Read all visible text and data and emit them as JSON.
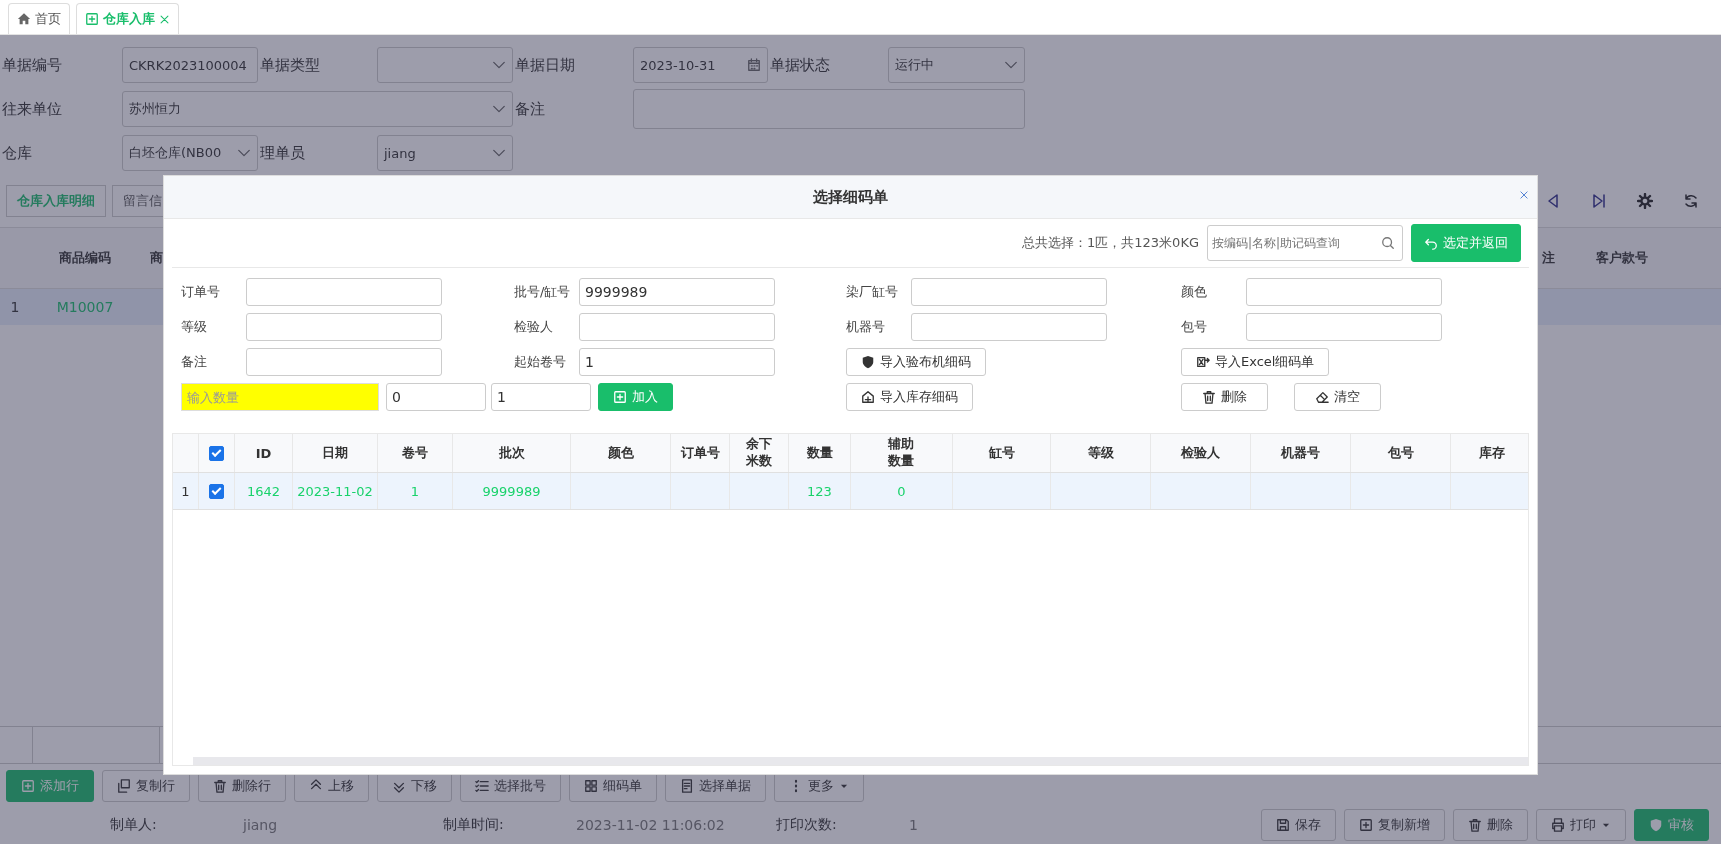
{
  "top_tabs": [
    {
      "label": "首页",
      "selected": false,
      "closable": false
    },
    {
      "label": "仓库入库",
      "selected": true,
      "closable": true
    }
  ],
  "form": {
    "fields": [
      {
        "label": "单据编号",
        "kind": "text",
        "value": "CKRK2023100004"
      },
      {
        "label": "单据类型",
        "kind": "select"
      },
      {
        "label": "单据日期",
        "kind": "date",
        "value": "2023-10-31"
      },
      {
        "label": "单据状态",
        "kind": "select",
        "value": "运行中"
      },
      {
        "label": "往来单位",
        "kind": "lookup",
        "value": "苏州恒力"
      },
      {
        "label": "备注",
        "kind": "textarea"
      },
      {
        "label": "仓库",
        "kind": "select",
        "value": "白坯仓库(NB00"
      },
      {
        "label": "理单员",
        "kind": "select",
        "value": "jiang"
      }
    ]
  },
  "detail_tabs": [
    {
      "label": "仓库入库明细",
      "selected": true
    },
    {
      "label": "留言信",
      "selected": false
    }
  ],
  "grid": {
    "columns": [
      "商品编码",
      "商",
      "注",
      "客户款号"
    ],
    "rows": [
      {
        "index": "1",
        "code": "M10007",
        "selected": true
      }
    ]
  },
  "toolbar": [
    {
      "label": "添加行",
      "kind": "primary"
    },
    {
      "label": "复制行",
      "kind": "default"
    },
    {
      "label": "删除行",
      "kind": "default"
    },
    {
      "label": "上移",
      "kind": "default"
    },
    {
      "label": "下移",
      "kind": "default"
    },
    {
      "label": "选择批号",
      "kind": "default"
    },
    {
      "label": "细码单",
      "kind": "default"
    },
    {
      "label": "选择单据",
      "kind": "default"
    },
    {
      "label": "更多",
      "kind": "dropdown"
    }
  ],
  "footer": {
    "info": [
      {
        "label": "制单人:",
        "value": "jiang"
      },
      {
        "label": "制单时间:",
        "value": "2023-11-02 11:06:02"
      },
      {
        "label": "打印次数:",
        "value": "1"
      }
    ],
    "buttons": [
      {
        "label": "保存",
        "kind": "default"
      },
      {
        "label": "复制新增",
        "kind": "default"
      },
      {
        "label": "删除",
        "kind": "default"
      },
      {
        "label": "打印",
        "kind": "dropdown"
      },
      {
        "label": "审核",
        "kind": "primary"
      }
    ]
  },
  "dialog": {
    "title": "选择细码单",
    "summary": "总共选择：1匹，共123米0KG",
    "search": {
      "placeholder": "按编码|名称|助记码查询"
    },
    "confirm": "选定并返回",
    "fields": [
      {
        "label": "订单号"
      },
      {
        "label": "批号/缸号",
        "value": "9999989"
      },
      {
        "label": "染厂缸号"
      },
      {
        "label": "颜色"
      },
      {
        "label": "等级"
      },
      {
        "label": "检验人"
      },
      {
        "label": "机器号"
      },
      {
        "label": "包号"
      },
      {
        "label": "备注"
      },
      {
        "label": "起始卷号",
        "value": "1"
      }
    ],
    "add_row": {
      "placeholder": "输入数量",
      "values": [
        "0",
        "1"
      ],
      "button": "加入"
    },
    "actions": [
      "导入验布机细码",
      "导入Excel细码单",
      "导入库存细码",
      "删除",
      "清空"
    ],
    "table": {
      "all_checked": true,
      "columns": [
        "ID",
        "日期",
        "卷号",
        "批次",
        "颜色",
        "订单号",
        "余下米数",
        "数量",
        "辅助数量",
        "缸号",
        "等级",
        "检验人",
        "机器号",
        "包号",
        "库存"
      ],
      "rows": [
        {
          "index": "1",
          "checked": true,
          "cells": [
            "1642",
            "2023-11-02",
            "1",
            "9999989",
            null,
            null,
            null,
            "123",
            "0",
            null,
            null,
            null,
            null,
            null,
            null
          ]
        }
      ]
    }
  }
}
